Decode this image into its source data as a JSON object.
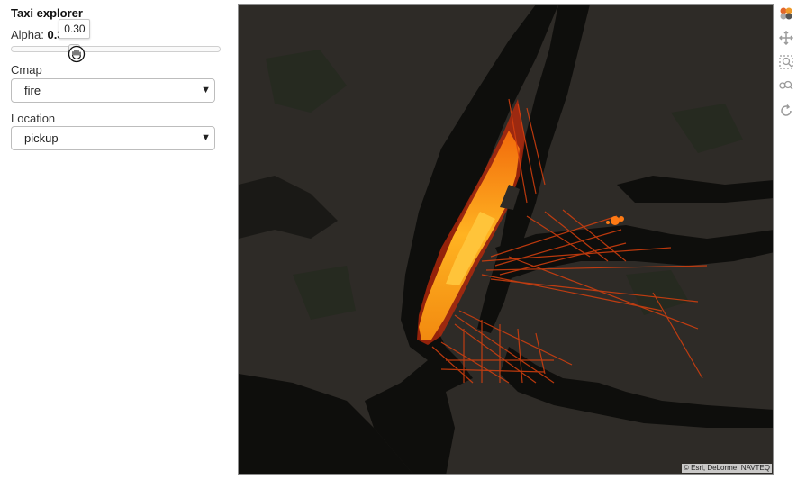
{
  "panel": {
    "title": "Taxi explorer",
    "alpha_label": "Alpha: ",
    "alpha_value": "0.3",
    "alpha_tooltip": "0.30",
    "alpha_fraction": 0.3,
    "cmap_label": "Cmap",
    "cmap_selected": "fire",
    "location_label": "Location",
    "location_selected": "pickup"
  },
  "map": {
    "attribution": "© Esri, DeLorme, NAVTEQ",
    "colors": {
      "land": "#2e2b27",
      "water": "#0e0e0c",
      "park": "#262a20",
      "heat_low": "#b8200a",
      "heat_mid": "#f26a0c",
      "heat_high": "#ffb321"
    }
  },
  "toolbar": {
    "icons": [
      "bokeh-logo-icon",
      "pan-icon",
      "box-zoom-icon",
      "wheel-zoom-icon",
      "reset-icon"
    ]
  }
}
